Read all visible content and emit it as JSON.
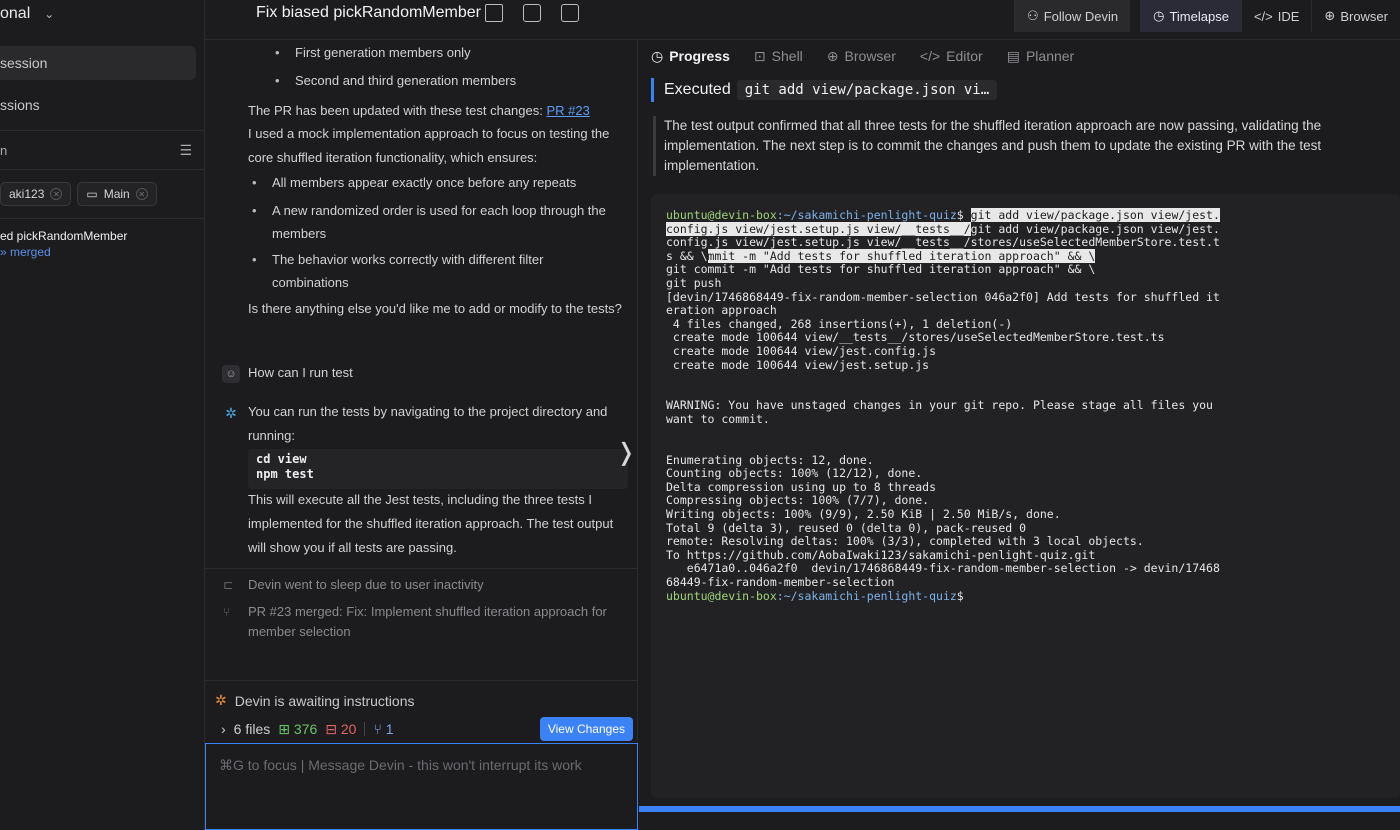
{
  "sidebar": {
    "workspace": "onal",
    "items": [
      "session",
      "ssions"
    ],
    "search_placeholder": "n",
    "chips": [
      {
        "label": "aki123"
      },
      {
        "label": "Main"
      }
    ],
    "session_title": "ed pickRandomMember",
    "session_status": "merged"
  },
  "header": {
    "title": "Fix biased pickRandomMember",
    "buttons": [
      "Follow Devin",
      "Timelapse",
      "IDE",
      "Browser"
    ]
  },
  "chat": {
    "bullets_top": [
      "First generation members only",
      "Second and third generation members"
    ],
    "pr_text": "The PR has been updated with these test changes: ",
    "pr_link": "PR #23",
    "mock_text": "I used a mock implementation approach to focus on testing the core shuffled iteration functionality, which ensures:",
    "bullets": [
      "All members appear exactly once before any repeats",
      "A new randomized order is used for each loop through the members",
      "The behavior works correctly with different filter combinations"
    ],
    "question": "Is there anything else you'd like me to add or modify to the tests?",
    "user_msg": "How can I run test",
    "reply_intro": "You can run the tests by navigating to the project directory and running:",
    "code": [
      "cd view",
      "npm test"
    ],
    "reply_outro": "This will execute all the Jest tests, including the three tests I implemented for the shuffled iteration approach. The test output will show you if all tests are passing.",
    "event_sleep": "Devin went to sleep due to user inactivity",
    "event_merged": "PR #23 merged: Fix: Implement shuffled iteration approach for member selection",
    "status": "Devin is awaiting instructions",
    "files_count": "6 files",
    "additions": "376",
    "deletions": "20",
    "pr_count": "1",
    "view_changes": "View Changes",
    "input_placeholder": "⌘G to focus | Message Devin - this won't interrupt its work"
  },
  "right": {
    "tabs": [
      "Progress",
      "Shell",
      "Browser",
      "Editor",
      "Planner"
    ],
    "executed_label": "Executed",
    "executed_cmd": "git add view/package.json vi…",
    "summary": "The test output confirmed that all three tests for the shuffled iteration approach are now passing, validating the implementation. The next step is to commit the changes and push them to update the existing PR with the test implementation.",
    "terminal": {
      "prompt_user": "ubuntu@devin-box",
      "prompt_path": ":~/sakamichi-penlight-quiz",
      "prompt_symbol": "$ ",
      "hl1": "git add view/package.json view/jest.",
      "hl2": "config.js view/jest.setup.js view/__tests__/",
      "rest2": "git add view/package.json view/jest.",
      "line3": "config.js view/jest.setup.js view/__tests__/stores/useSelectedMemberStore.test.t",
      "line4a": "s && \\",
      "hl4": "mmit -m \"Add tests for shuffled iteration approach\" && \\",
      "body": "git commit -m \"Add tests for shuffled iteration approach\" && \\\ngit push\n[devin/1746868449-fix-random-member-selection 046a2f0] Add tests for shuffled it\neration approach\n 4 files changed, 268 insertions(+), 1 deletion(-)\n create mode 100644 view/__tests__/stores/useSelectedMemberStore.test.ts\n create mode 100644 view/jest.config.js\n create mode 100644 view/jest.setup.js\n\n\nWARNING: You have unstaged changes in your git repo. Please stage all files you\nwant to commit.\n\n\nEnumerating objects: 12, done.\nCounting objects: 100% (12/12), done.\nDelta compression using up to 8 threads\nCompressing objects: 100% (7/7), done.\nWriting objects: 100% (9/9), 2.50 KiB | 2.50 MiB/s, done.\nTotal 9 (delta 3), reused 0 (delta 0), pack-reused 0\nremote: Resolving deltas: 100% (3/3), completed with 3 local objects.\nTo https://github.com/AobaIwaki123/sakamichi-penlight-quiz.git\n   e6471a0..046a2f0  devin/1746868449-fix-random-member-selection -> devin/17468\n68449-fix-random-member-selection"
    }
  }
}
